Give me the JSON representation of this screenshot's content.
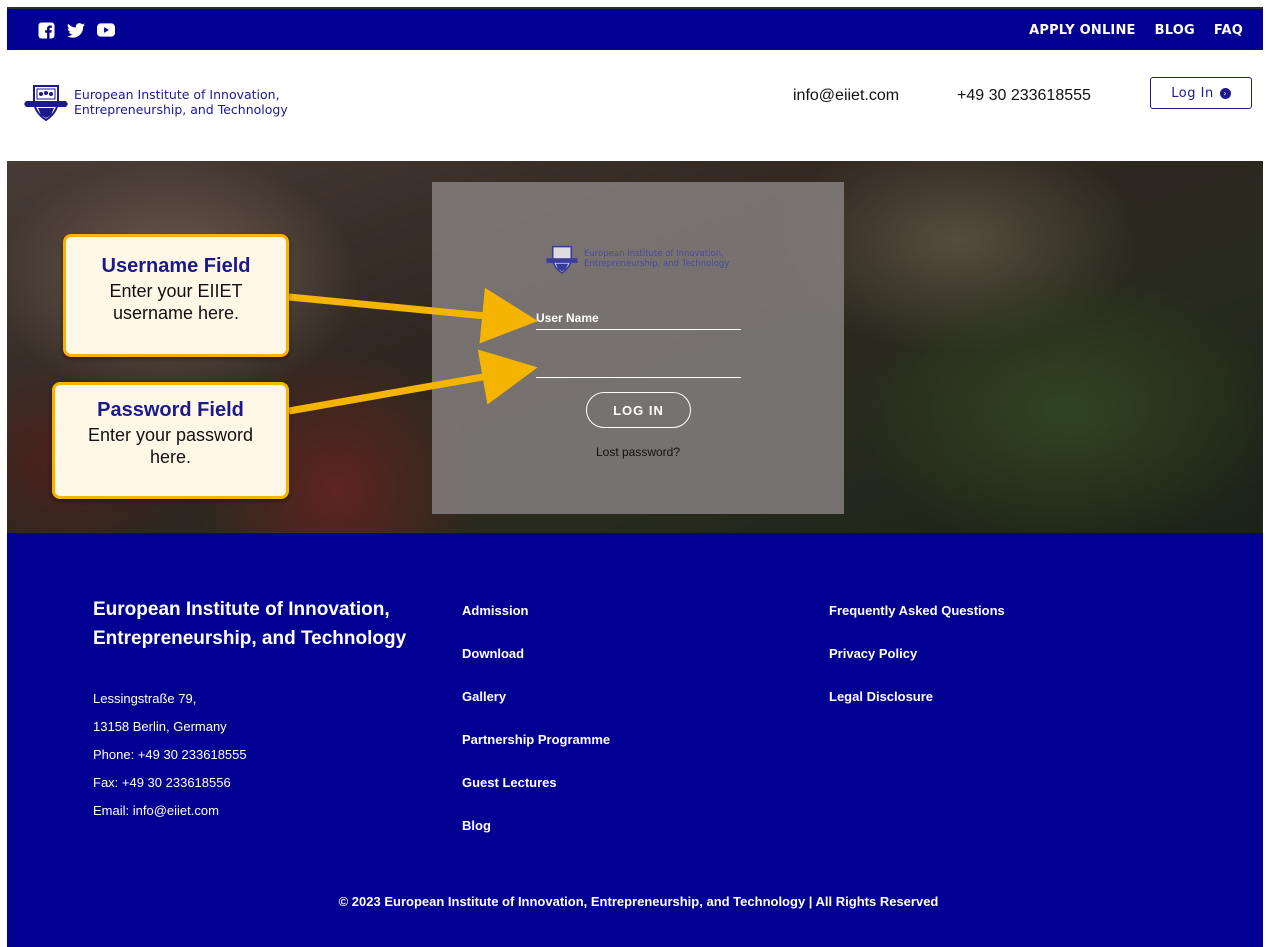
{
  "topbar": {
    "social": [
      "facebook-icon",
      "twitter-icon",
      "youtube-icon"
    ],
    "nav": [
      "APPLY ONLINE",
      "BLOG",
      "FAQ"
    ]
  },
  "header": {
    "brand_line1": "European Institute of Innovation,",
    "brand_line2": "Entrepreneurship, and Technology",
    "email": "info@eiiet.com",
    "phone": "+49 30 233618555",
    "login_label": "Log In"
  },
  "login_form": {
    "brand_line1": "European Institute of Innovation,",
    "brand_line2": "Entrepreneurship, and Technology",
    "username_placeholder": "User Name",
    "password_placeholder": "",
    "submit_label": "LOG IN",
    "lost_password": "Lost password?"
  },
  "callouts": {
    "username_title": "Username Field",
    "username_line1": "Enter your EIIET",
    "username_line2": "username here.",
    "password_title": "Password Field",
    "password_line1": "Enter your password",
    "password_line2": "here."
  },
  "footer": {
    "title_line1": "European Institute of Innovation,",
    "title_line2": "Entrepreneurship, and Technology",
    "address": [
      "Lessingstraße 79,",
      "13158 Berlin, Germany",
      "Phone: +49 30 233618555",
      "Fax: +49 30 233618556",
      "Email: info@eiiet.com"
    ],
    "links_col1": [
      "Admission",
      "Download",
      "Gallery",
      "Partnership Programme",
      "Guest Lectures",
      "Blog"
    ],
    "links_col2": [
      "Frequently Asked Questions",
      "Privacy Policy",
      "Legal Disclosure"
    ],
    "copyright": "© 2023 European Institute of Innovation, Entrepreneurship, and Technology | All Rights Reserved"
  },
  "colors": {
    "brand_blue": "#020092",
    "callout_border": "#f5b400",
    "callout_bg": "#fff8e6"
  }
}
